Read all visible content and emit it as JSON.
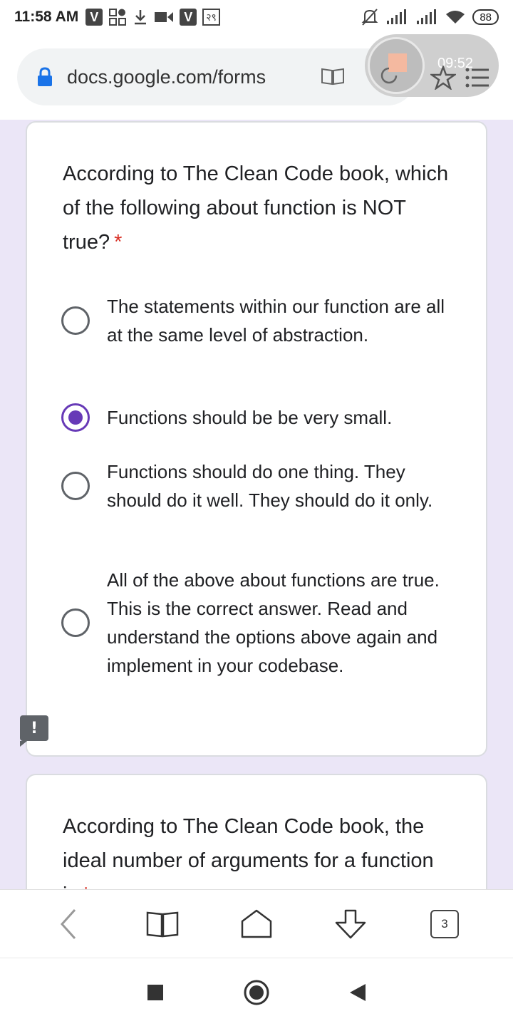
{
  "status_bar": {
    "time": "11:58 AM",
    "indicator": "२९",
    "battery": "88"
  },
  "browser": {
    "url": "docs.google.com/forms",
    "overlay_timer": "09:52",
    "tab_count": "3"
  },
  "form": {
    "question1": {
      "text": "According to The Clean Code book, which of the following about function is NOT true?",
      "required_mark": "*",
      "options": [
        {
          "label": "The statements within our function are all at the same level of abstraction.",
          "selected": false
        },
        {
          "label": "Functions should be be very small.",
          "selected": true
        },
        {
          "label": "Functions should do one thing. They should do it well. They should do it only.",
          "selected": false
        },
        {
          "label": "All of the above about functions are true. This is the correct answer. Read and understand the options above again and implement in your codebase.",
          "selected": false
        }
      ]
    },
    "question2": {
      "text": "According to The Clean Code book, the ideal number of arguments for a function is",
      "required_mark": "*"
    }
  },
  "colors": {
    "accent": "#673ab7",
    "background": "#ebe6f7",
    "required": "#d93025"
  }
}
